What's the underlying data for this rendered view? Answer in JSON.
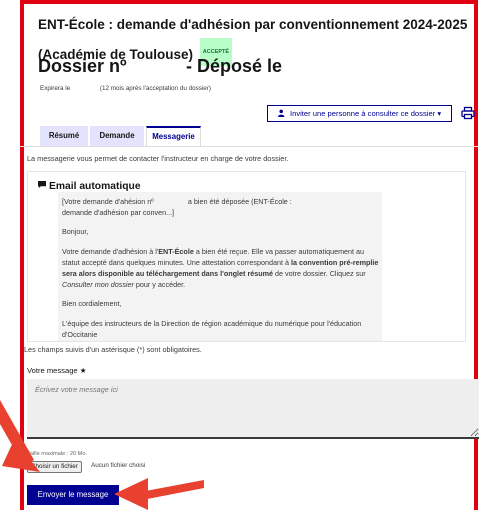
{
  "header": {
    "title": "ENT-École : demande d'adhésion par conventionnement 2024-2025 (Académie de Toulouse)",
    "status_badge": "ACCEPTÉ",
    "dossier_label": "Dossier nº",
    "depose_label": "- Déposé le",
    "expire_label": "Expirera le",
    "expire_note": "(12 mois après l'acceptation du dossier)"
  },
  "actions": {
    "invite_label": "Inviter une personne à consulter ce dossier",
    "invite_icon": "person-add-icon",
    "print_icon": "printer-icon"
  },
  "tabs": [
    {
      "label": "Résumé"
    },
    {
      "label": "Demande"
    },
    {
      "label": "Messagerie",
      "active": true
    }
  ],
  "messagerie": {
    "intro": "La messagerie vous permet de contacter l'instructeur en charge de votre dossier.",
    "message": {
      "sender": "Email automatique",
      "line1": "[Votre demande d'ahésion nº",
      "line1b": "a bien été déposée (ENT-École :",
      "line2": "demande d'adhésion par conven...]",
      "greeting": "Bonjour,",
      "body_part1": "Votre demande d'adhésion à l'",
      "body_bold1": "ENT-École",
      "body_part2": " a bien été reçue. Elle va passer automatiquement au statut accepté dans quelques minutes. Une attestation correspondant à ",
      "body_bold2": "la convention pré-remplie sera alors disponible au téléchargement dans l'onglet résumé",
      "body_part3": " de votre dossier. Cliquez sur ",
      "body_italic": "Consulter mon dossier",
      "body_part4": " pour y accéder.",
      "closing": "Bien cordialement,",
      "signature": "L'équipe des instructeurs de la Direction de région académique du numérique pour l'éducation d'Occitanie"
    }
  },
  "form": {
    "required_note": "Les champs suivis d'un astérisque (*) sont obligatoires.",
    "message_label": "Votre message",
    "required_star": "★",
    "message_placeholder": "Écrivez votre message ici",
    "max_size": "Taille maximale : 20 Mo.",
    "file_button": "Choisir un fichier",
    "no_file": "Aucun fichier choisi",
    "send_button": "Envoyer le message"
  },
  "colors": {
    "frame": "#e1000f",
    "primary": "#000091",
    "badge_bg": "#b8fec9",
    "badge_text": "#18753c",
    "arrow": "#e8412f"
  }
}
